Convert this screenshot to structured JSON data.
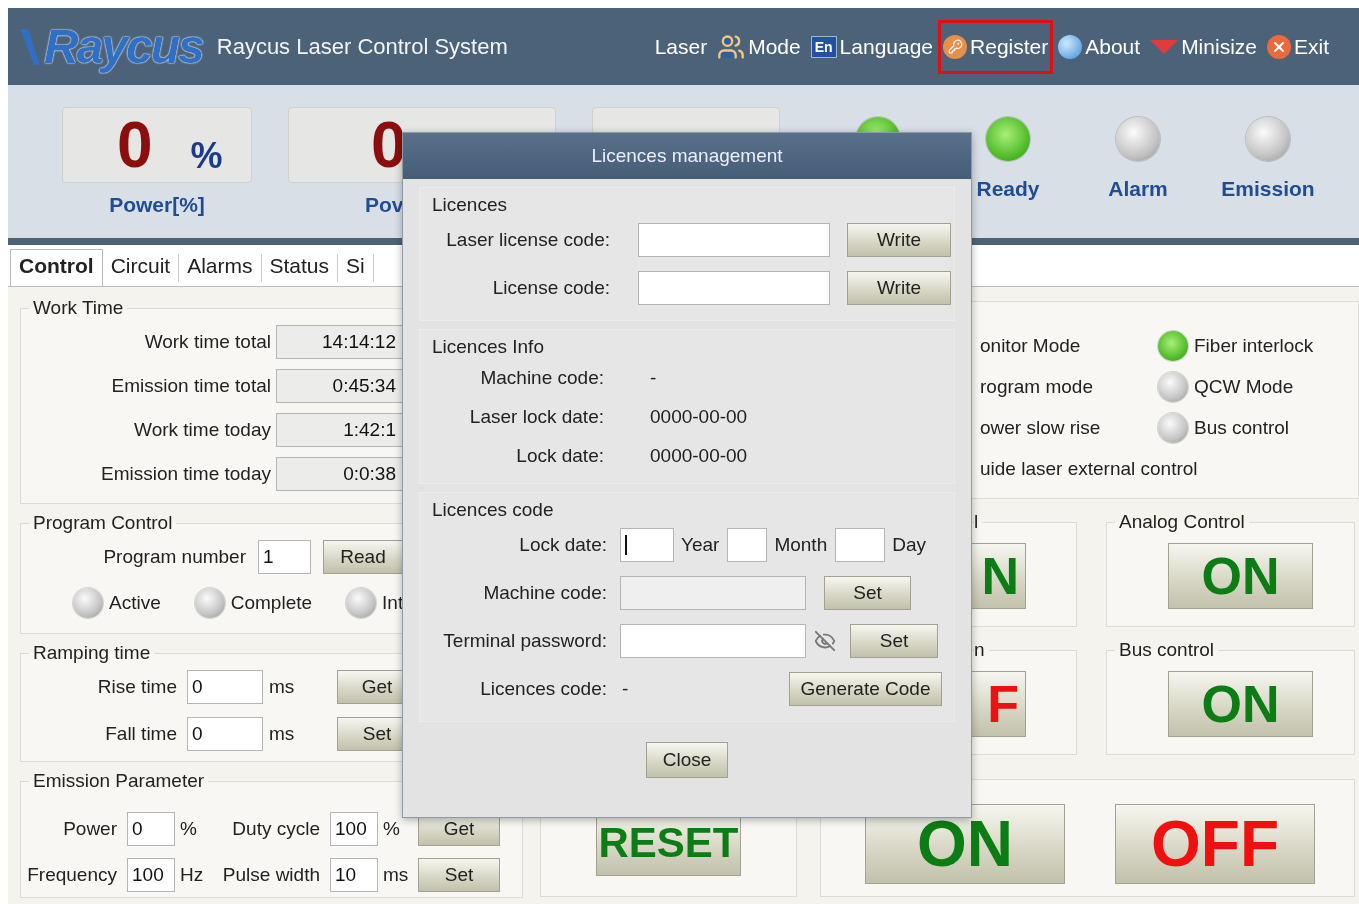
{
  "header": {
    "logo": "Raycus",
    "title": "Raycus Laser Control System",
    "menu": [
      {
        "kind": "text",
        "label": "Laser",
        "highlighted": false
      },
      {
        "kind": "people",
        "label": "Mode",
        "highlighted": false
      },
      {
        "kind": "badge",
        "badge": "En",
        "label": "Language",
        "highlighted": false
      },
      {
        "kind": "key",
        "label": "Register",
        "highlighted": true
      },
      {
        "kind": "globe",
        "label": "About",
        "highlighted": false
      },
      {
        "kind": "triangle",
        "label": "Minisize",
        "highlighted": false
      },
      {
        "kind": "close",
        "label": "Exit",
        "highlighted": false
      }
    ]
  },
  "gauges": [
    {
      "value": "0",
      "unit": "%",
      "label": "Power[%]"
    },
    {
      "value": "0",
      "label": "Pov"
    }
  ],
  "indicators": [
    {
      "on": true
    },
    {
      "label": "Ready",
      "on": true
    },
    {
      "label": "Alarm",
      "on": false
    },
    {
      "label": "Emission",
      "on": false
    }
  ],
  "tabs": [
    {
      "label": "Control",
      "selected": true
    },
    {
      "label": "Circuit",
      "selected": false
    },
    {
      "label": "Alarms",
      "selected": false
    },
    {
      "label": "Status",
      "selected": false
    },
    {
      "label": "Si",
      "selected": false
    }
  ],
  "work_time": {
    "title": "Work Time",
    "rows": [
      {
        "label": "Work time total",
        "value": "14:14:12"
      },
      {
        "label": "Emission time total",
        "value": "0:45:34"
      },
      {
        "label": "Work time today",
        "value": "1:42:1"
      },
      {
        "label": "Emission time today",
        "value": "0:0:38"
      }
    ]
  },
  "program_control": {
    "title": "Program Control",
    "number_label": "Program number",
    "number": "1",
    "button": "Read",
    "states": [
      {
        "label": "Active",
        "on": false
      },
      {
        "label": "Complete",
        "on": false
      },
      {
        "label": "Int",
        "on": false
      }
    ]
  },
  "ramping": {
    "title": "Ramping time",
    "rows": [
      {
        "label": "Rise time",
        "value": "0",
        "unit": "ms",
        "button": "Get"
      },
      {
        "label": "Fall time",
        "value": "0",
        "unit": "ms",
        "button": "Set"
      }
    ]
  },
  "emission_parameter": {
    "title": "Emission Parameter",
    "rows": [
      {
        "fields": [
          {
            "label": "Power",
            "value": "0",
            "unit": "%"
          },
          {
            "label": "Duty cycle",
            "value": "100",
            "unit": "%"
          }
        ],
        "button": "Get"
      },
      {
        "fields": [
          {
            "label": "Frequency",
            "value": "100",
            "unit": "Hz"
          },
          {
            "label": "Pulse width",
            "value": "10",
            "unit": "ms"
          }
        ],
        "button": "Set"
      }
    ]
  },
  "modes": {
    "items": [
      {
        "label": "onitor Mode"
      },
      {
        "label": "rogram mode"
      },
      {
        "label": "ower slow rise"
      },
      {
        "label": "uide laser external control"
      }
    ],
    "status": [
      {
        "label": "Fiber interlock",
        "on": true
      },
      {
        "label": "QCW Mode",
        "on": false
      },
      {
        "label": "Bus control",
        "on": false
      }
    ]
  },
  "switch_groups": [
    {
      "title": "l",
      "button": "N",
      "kind": "on"
    },
    {
      "title": "Analog Control",
      "button": "ON",
      "kind": "on"
    },
    {
      "title": "n",
      "button": "F",
      "kind": "off"
    },
    {
      "title": "Bus control",
      "button": "ON",
      "kind": "on"
    }
  ],
  "reset_button": "RESET",
  "laser_buttons": [
    {
      "label": "ON",
      "kind": "on"
    },
    {
      "label": "OFF",
      "kind": "off"
    }
  ],
  "dialog": {
    "title": "Licences management",
    "licences": {
      "title": "Licences",
      "rows": [
        {
          "label": "Laser license code:",
          "button": "Write"
        },
        {
          "label": "License code:",
          "button": "Write"
        }
      ]
    },
    "info": {
      "title": "Licences Info",
      "rows": [
        {
          "label": "Machine code:",
          "value": "-"
        },
        {
          "label": "Laser lock date:",
          "value": "0000-00-00"
        },
        {
          "label": "Lock date:",
          "value": "0000-00-00"
        }
      ]
    },
    "code": {
      "title": "Licences code",
      "lock_date_label": "Lock date:",
      "date_fields": [
        {
          "unit": "Year",
          "focused": true
        },
        {
          "unit": "Month",
          "focused": false
        },
        {
          "unit": "Day",
          "focused": false
        }
      ],
      "machine_label": "Machine code:",
      "machine_disabled": true,
      "machine_button": "Set",
      "password_label": "Terminal password:",
      "password_button": "Set",
      "code_label": "Licences code:",
      "code_value": "-",
      "generate_button": "Generate Code"
    },
    "close_button": "Close"
  }
}
